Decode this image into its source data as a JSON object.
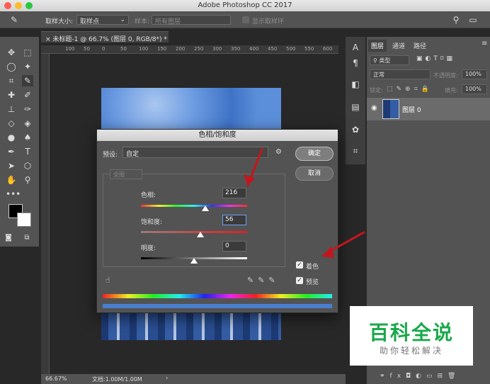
{
  "window": {
    "title": "Adobe Photoshop CC 2017"
  },
  "options_bar": {
    "sample_size_label": "取样大小:",
    "sample_size_value": "取样点",
    "sample_label": "样本:",
    "sample_value": "所有图层",
    "show_ring_label": "显示取样环"
  },
  "document": {
    "tab_title": "未标题-1 @ 66.7% (图层 0, RGB/8*) *",
    "ruler_ticks": [
      "100",
      "50",
      "0",
      "50",
      "100",
      "150",
      "200",
      "250",
      "300",
      "350",
      "400",
      "450",
      "500",
      "550",
      "600"
    ],
    "zoom": "66.67%",
    "doc_info": "文档:1.00M/1.00M"
  },
  "layers_panel": {
    "tabs": [
      "图层",
      "通道",
      "路径"
    ],
    "kind_label": "类型",
    "blend_mode": "正常",
    "opacity_label": "不透明度:",
    "opacity_value": "100%",
    "lock_label": "锁定:",
    "fill_label": "填充:",
    "fill_value": "100%",
    "layer_name": "图层 0"
  },
  "dialog": {
    "title": "色相/饱和度",
    "preset_label": "预设:",
    "preset_value": "自定",
    "ok_label": "确定",
    "cancel_label": "取消",
    "channel_value": "全图",
    "hue_label": "色相:",
    "hue_value": "216",
    "saturation_label": "饱和度:",
    "saturation_value": "56",
    "lightness_label": "明度:",
    "lightness_value": "0",
    "colorize_label": "着色",
    "colorize_checked": true,
    "preview_label": "预览",
    "preview_checked": true
  },
  "watermark": {
    "line1": "百科全说",
    "line2": "助你轻松解决"
  },
  "colors": {
    "accent_arrow": "#c4161c",
    "watermark_green": "#1aa84b"
  }
}
